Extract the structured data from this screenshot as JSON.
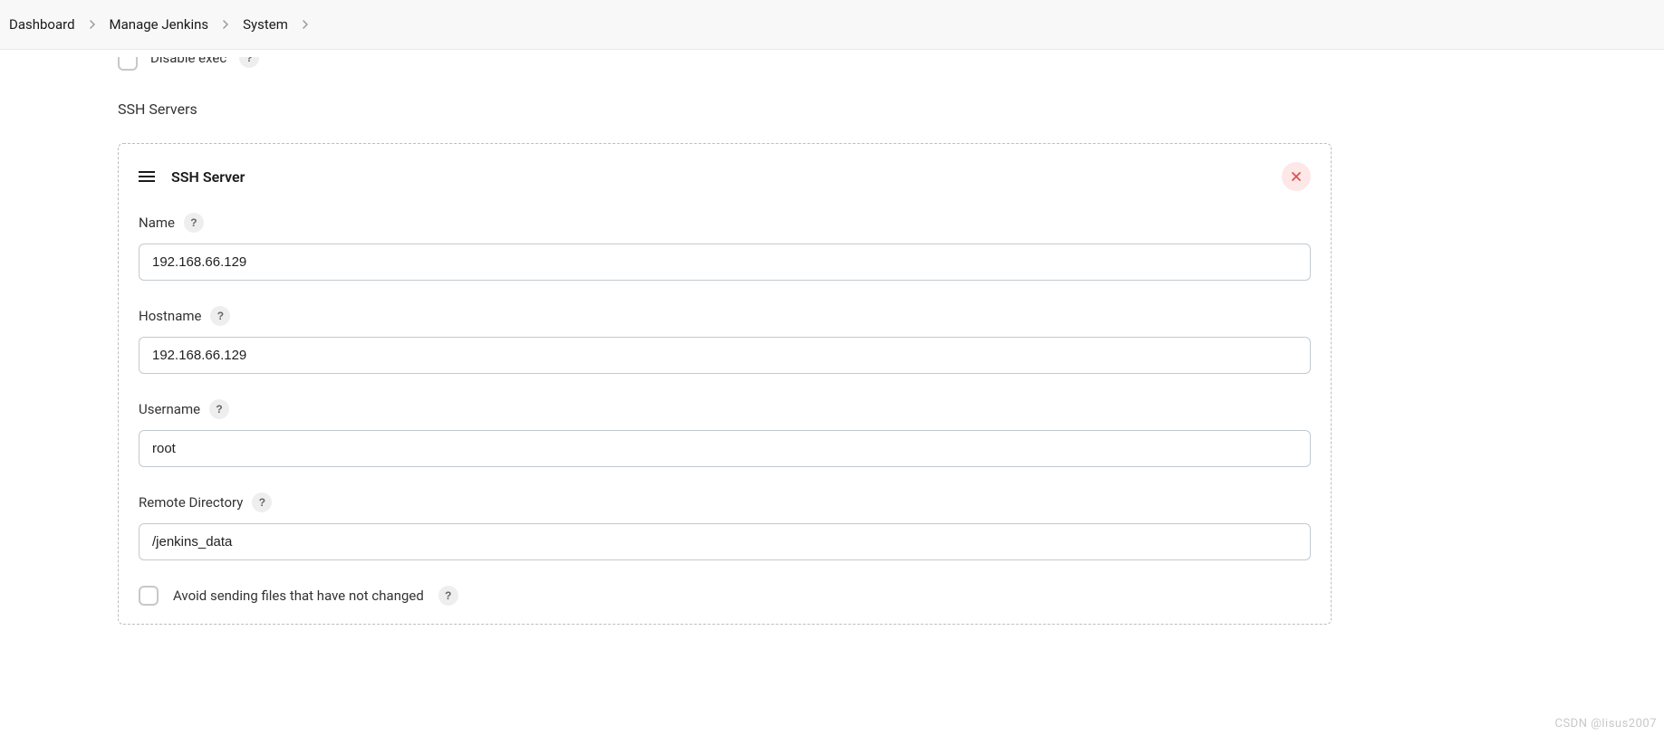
{
  "breadcrumb": {
    "items": [
      "Dashboard",
      "Manage Jenkins",
      "System"
    ]
  },
  "partial": {
    "disable_exec_label": "Disable exec"
  },
  "section": {
    "title": "SSH Servers"
  },
  "server": {
    "title": "SSH Server",
    "fields": {
      "name": {
        "label": "Name",
        "value": "192.168.66.129"
      },
      "hostname": {
        "label": "Hostname",
        "value": "192.168.66.129"
      },
      "username": {
        "label": "Username",
        "value": "root"
      },
      "remote_directory": {
        "label": "Remote Directory",
        "value": "/jenkins_data"
      }
    },
    "avoid_send": {
      "label": "Avoid sending files that have not changed",
      "checked": false
    }
  },
  "help_glyph": "?",
  "watermark": "CSDN @lisus2007"
}
